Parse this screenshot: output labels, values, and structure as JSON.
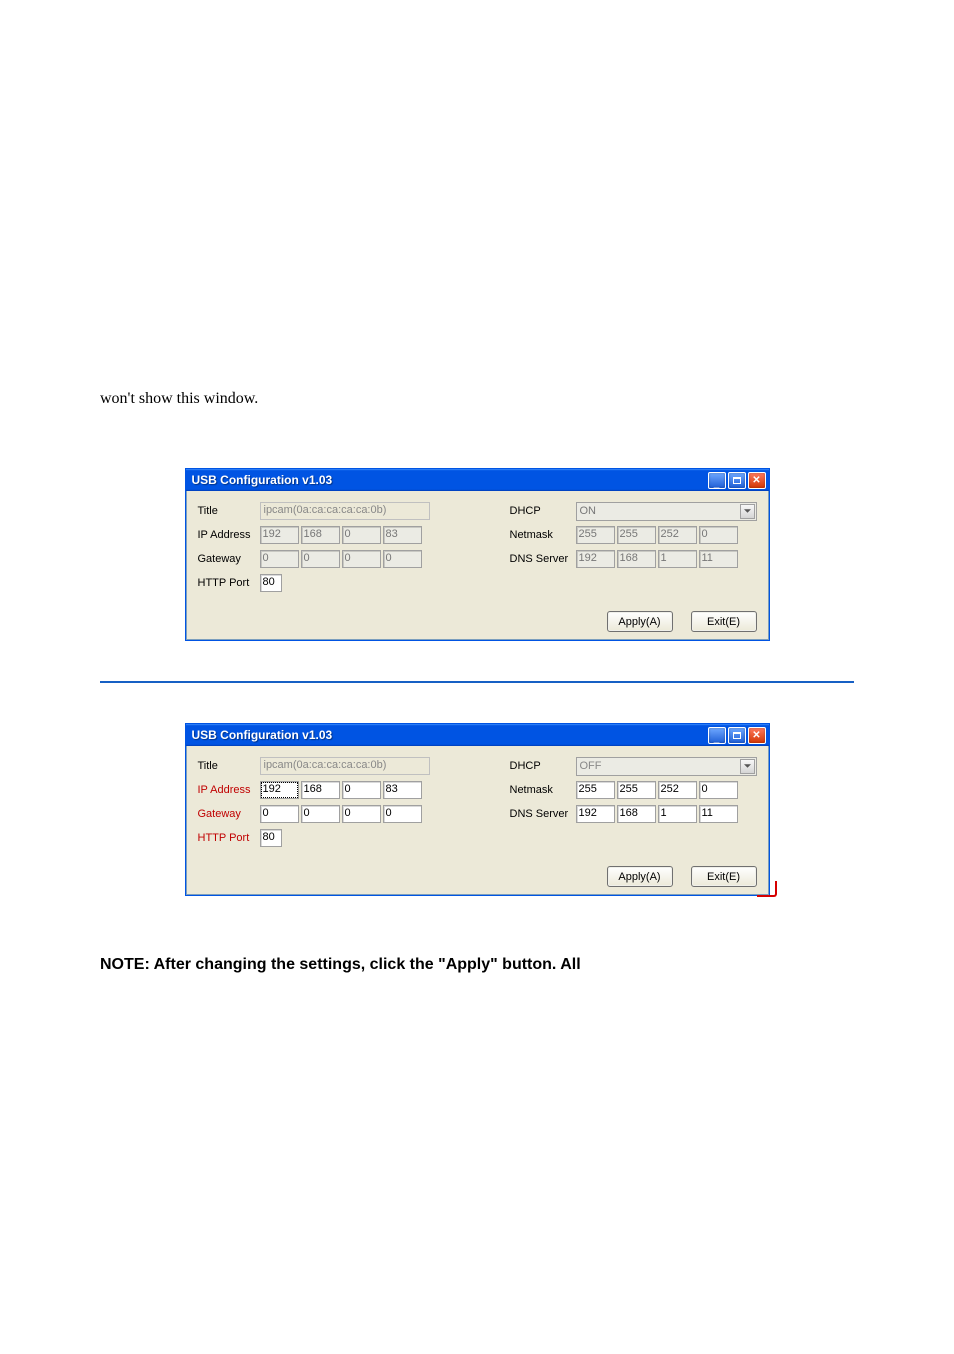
{
  "intro_text": "won't show this window.",
  "note_text": "NOTE: After changing the settings, click the \"Apply\" button. All",
  "window1": {
    "title": "USB Configuration v1.03",
    "labels": {
      "title": "Title",
      "ip": "IP Address",
      "gateway": "Gateway",
      "http": "HTTP Port",
      "dhcp": "DHCP",
      "netmask": "Netmask",
      "dns": "DNS Server"
    },
    "title_value": "ipcam(0a:ca:ca:ca:ca:0b)",
    "ip": [
      "192",
      "168",
      "0",
      "83"
    ],
    "gateway": [
      "0",
      "0",
      "0",
      "0"
    ],
    "http_port": "80",
    "dhcp": "ON",
    "netmask": [
      "255",
      "255",
      "252",
      "0"
    ],
    "dns": [
      "192",
      "168",
      "1",
      "11"
    ],
    "buttons": {
      "apply": "Apply(A)",
      "exit": "Exit(E)"
    }
  },
  "window2": {
    "title": "USB Configuration v1.03",
    "labels": {
      "title": "Title",
      "ip": "IP Address",
      "gateway": "Gateway",
      "http": "HTTP Port",
      "dhcp": "DHCP",
      "netmask": "Netmask",
      "dns": "DNS Server"
    },
    "title_value": "ipcam(0a:ca:ca:ca:ca:0b)",
    "ip": [
      "192",
      "168",
      "0",
      "83"
    ],
    "gateway": [
      "0",
      "0",
      "0",
      "0"
    ],
    "http_port": "80",
    "dhcp": "OFF",
    "netmask": [
      "255",
      "255",
      "252",
      "0"
    ],
    "dns": [
      "192",
      "168",
      "1",
      "11"
    ],
    "buttons": {
      "apply": "Apply(A)",
      "exit": "Exit(E)"
    }
  }
}
